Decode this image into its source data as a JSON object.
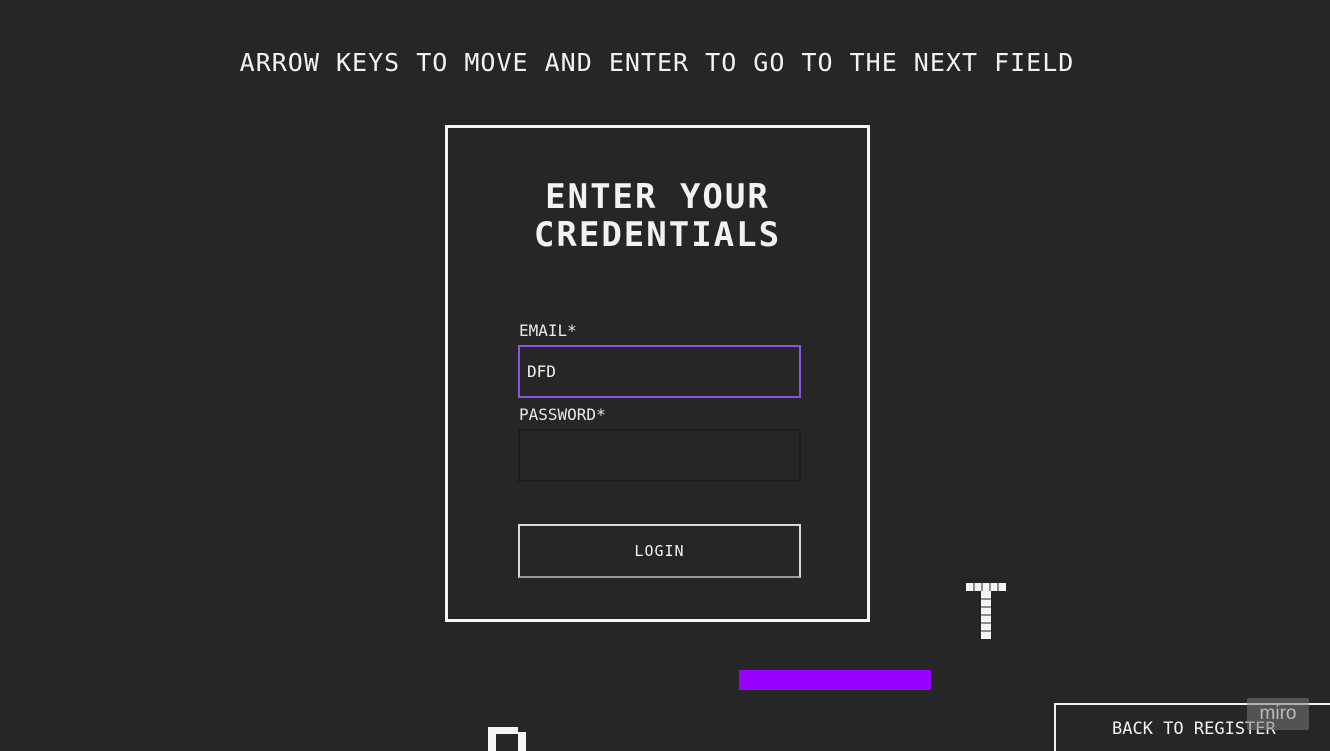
{
  "instructions": "ARROW KEYS TO MOVE AND ENTER TO GO TO THE NEXT FIELD",
  "panel": {
    "title": "ENTER YOUR\nCREDENTIALS",
    "email_label": "EMAIL*",
    "email_value": "DFD",
    "password_label": "PASSWORD*",
    "password_value": "",
    "login_label": "LOGIN"
  },
  "back_button_label": "BACK TO REGISTER",
  "watermark": "miro",
  "colors": {
    "background": "#262626",
    "accent_purple": "#9900ff",
    "focus_border": "#8c52e0",
    "foreground": "#f2f2f2"
  },
  "decorations": {
    "pixel_letters": [
      "T",
      "D"
    ]
  }
}
